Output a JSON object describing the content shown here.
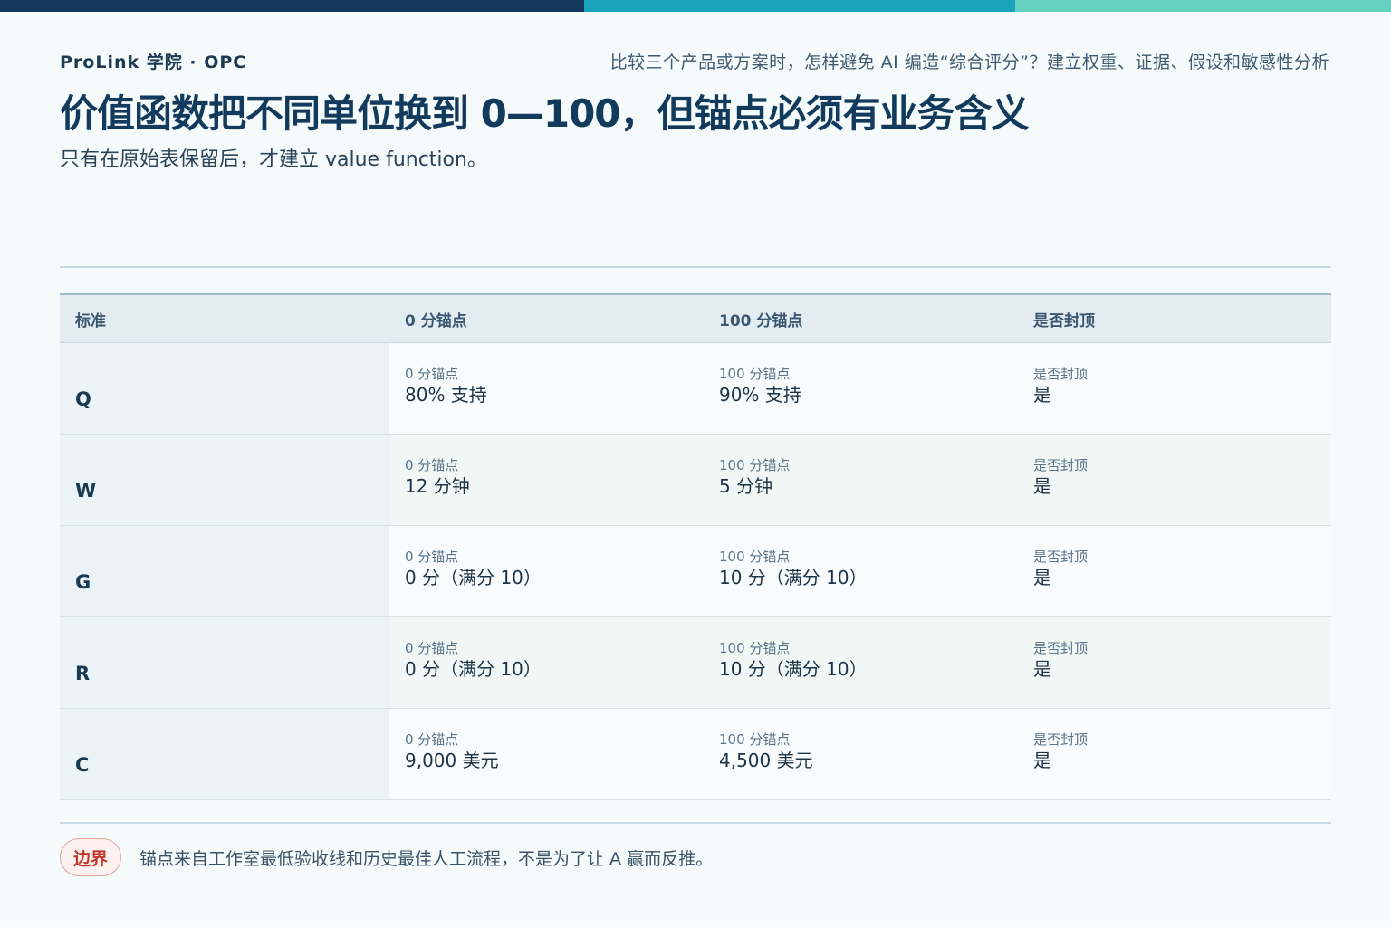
{
  "colors": {
    "bar_dark": "#12375a",
    "bar_mid": "#1aa3bd",
    "bar_light": "#66d0c0",
    "accent_red": "#c0392b"
  },
  "header": {
    "brand": "ProLink 学院 · OPC",
    "topic": "比较三个产品或方案时，怎样避免 AI 编造“综合评分”？建立权重、证据、假设和敏感性分析",
    "title": "价值函数把不同单位换到 0—100，但锚点必须有业务含义",
    "subtitle": "只有在原始表保留后，才建立 value function。"
  },
  "table": {
    "headers": [
      "标准",
      "0 分锚点",
      "100 分锚点",
      "是否封顶"
    ],
    "rows": [
      {
        "key": "Q",
        "zero_label": "0 分锚点",
        "zero": "80% 支持",
        "hundred_label": "100 分锚点",
        "hundred": "90% 支持",
        "cap_label": "是否封顶",
        "cap": "是"
      },
      {
        "key": "W",
        "zero_label": "0 分锚点",
        "zero": "12 分钟",
        "hundred_label": "100 分锚点",
        "hundred": "5 分钟",
        "cap_label": "是否封顶",
        "cap": "是"
      },
      {
        "key": "G",
        "zero_label": "0 分锚点",
        "zero": "0 分（满分 10）",
        "hundred_label": "100 分锚点",
        "hundred": "10 分（满分 10）",
        "cap_label": "是否封顶",
        "cap": "是"
      },
      {
        "key": "R",
        "zero_label": "0 分锚点",
        "zero": "0 分（满分 10）",
        "hundred_label": "100 分锚点",
        "hundred": "10 分（满分 10）",
        "cap_label": "是否封顶",
        "cap": "是"
      },
      {
        "key": "C",
        "zero_label": "0 分锚点",
        "zero": "9,000 美元",
        "hundred_label": "100 分锚点",
        "hundred": "4,500 美元",
        "cap_label": "是否封顶",
        "cap": "是"
      }
    ]
  },
  "footer": {
    "badge": "边界",
    "text": "锚点来自工作室最低验收线和历史最佳人工流程，不是为了让 A 赢而反推。"
  }
}
